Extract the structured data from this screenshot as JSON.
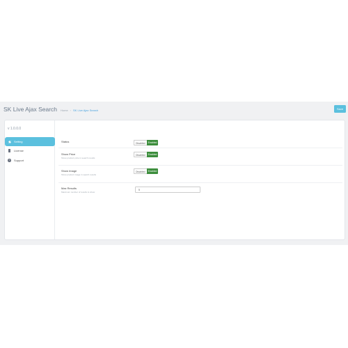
{
  "header": {
    "title": "SK Live Ajax Search",
    "breadcrumb": [
      "Home",
      "SK Live Ajax Search"
    ],
    "save_label": "Save"
  },
  "sidebar": {
    "version": "v 1.0.0.0",
    "items": [
      {
        "label": "Setting",
        "icon": "gear-icon",
        "active": true
      },
      {
        "label": "License",
        "icon": "document-icon",
        "active": false
      },
      {
        "label": "Support",
        "icon": "question-icon",
        "active": false
      }
    ]
  },
  "settings": [
    {
      "title": "Status",
      "description": "",
      "control": "toggle",
      "off_label": "Disabled",
      "on_label": "Enabled"
    },
    {
      "title": "Show Price",
      "description": "Show product price in search results",
      "control": "toggle",
      "off_label": "Disabled",
      "on_label": "Enabled"
    },
    {
      "title": "Show Image",
      "description": "Show product image in search results",
      "control": "toggle",
      "off_label": "Disabled",
      "on_label": "Enabled"
    },
    {
      "title": "Max Results",
      "description": "Maximum number of results to show",
      "control": "input",
      "value": "5"
    }
  ],
  "colors": {
    "accent": "#5bc0de",
    "enabled": "#3c8d3c",
    "link": "#4aa3df"
  }
}
